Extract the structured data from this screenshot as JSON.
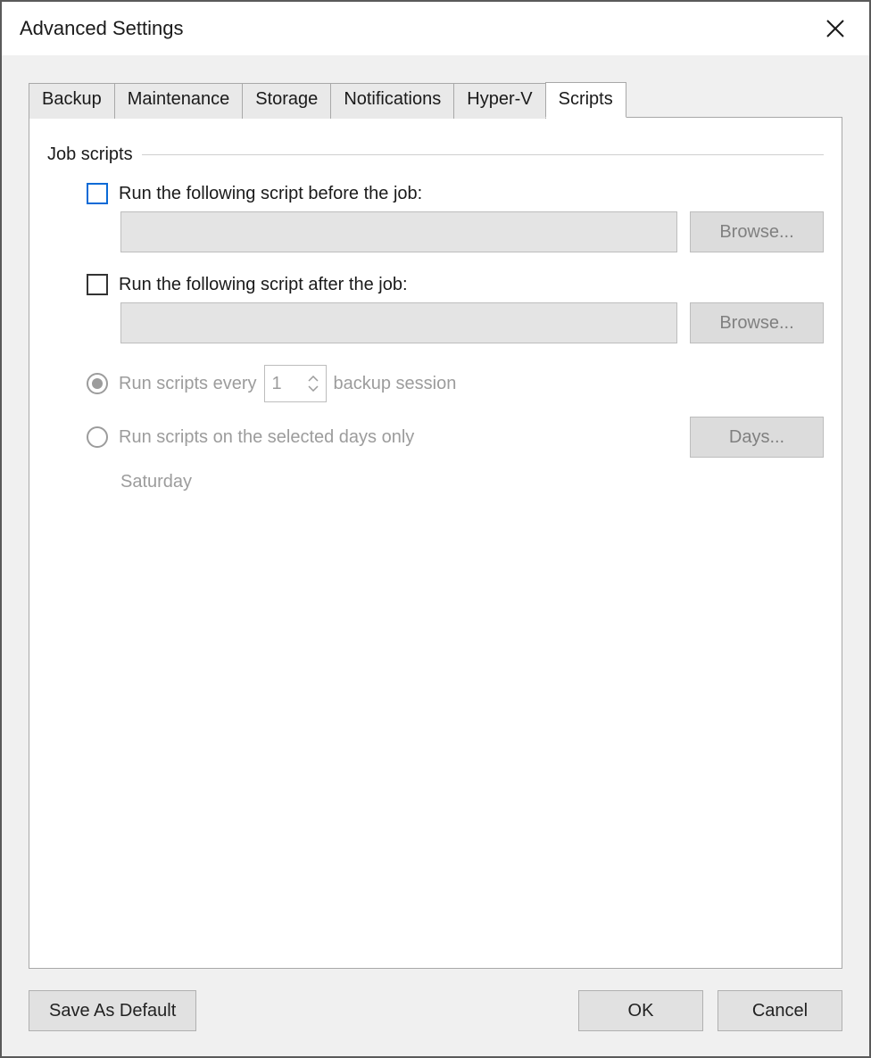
{
  "title": "Advanced Settings",
  "tabs": [
    {
      "label": "Backup"
    },
    {
      "label": "Maintenance"
    },
    {
      "label": "Storage"
    },
    {
      "label": "Notifications"
    },
    {
      "label": "Hyper-V"
    },
    {
      "label": "Scripts"
    }
  ],
  "group": {
    "title": "Job scripts",
    "before": {
      "label": "Run the following script before the job:",
      "value": "",
      "browse": "Browse..."
    },
    "after": {
      "label": "Run the following script after the job:",
      "value": "",
      "browse": "Browse..."
    },
    "radio1": {
      "prefix": "Run scripts every",
      "value": "1",
      "suffix": "backup session"
    },
    "radio2": {
      "label": "Run scripts on the selected days only",
      "days_button": "Days...",
      "selected_days": "Saturday"
    }
  },
  "footer": {
    "save_default": "Save As Default",
    "ok": "OK",
    "cancel": "Cancel"
  }
}
